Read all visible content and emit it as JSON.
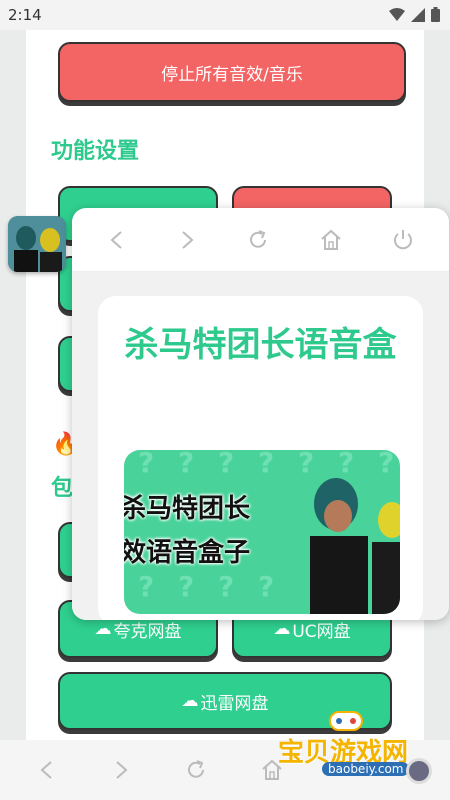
{
  "status_bar": {
    "time": "2:14"
  },
  "page": {
    "stop_button_label": "停止所有音效/音乐",
    "section_function": "功能设置",
    "section_pan_partial": "包",
    "fire_icon": "fire-icon",
    "cloud_buttons": [
      {
        "label": "夸克网盘"
      },
      {
        "label": "UC网盘"
      },
      {
        "label": "迅雷网盘"
      }
    ]
  },
  "popup": {
    "nav_icons": [
      "back-icon",
      "forward-icon",
      "refresh-icon",
      "home-icon",
      "power-icon"
    ],
    "card_title": "杀马特团长语音盒",
    "image_line1": "杀马特团长",
    "image_line2": "音效语音盒子"
  },
  "bottom_nav": {
    "icons": [
      "back-icon",
      "forward-icon",
      "refresh-icon",
      "home-icon"
    ]
  },
  "watermark": {
    "text": "宝贝游戏网",
    "url": "baobeiy.com"
  },
  "colors": {
    "accent_green": "#2ec98d",
    "button_green": "#2fd08f",
    "button_red": "#f36464"
  }
}
